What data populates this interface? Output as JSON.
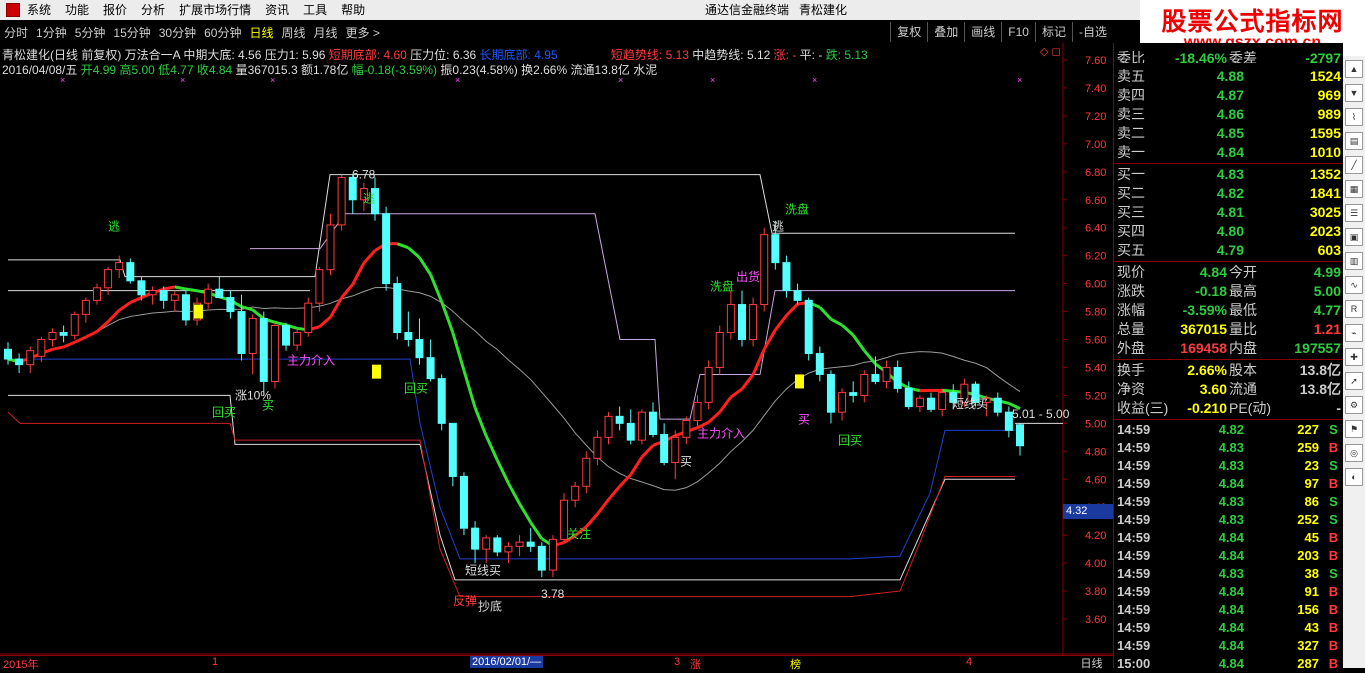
{
  "menu": [
    "系统",
    "功能",
    "报价",
    "分析",
    "扩展市场行情",
    "资讯",
    "工具",
    "帮助"
  ],
  "window_title": "通达信金融终端",
  "stock_title": "青松建化",
  "brand": {
    "line1": "股票公式指标网",
    "line2": "www.gszx.com.cn"
  },
  "periods": [
    "分时",
    "1分钟",
    "5分钟",
    "15分钟",
    "30分钟",
    "60分钟",
    "日线",
    "周线",
    "月线",
    "更多 >"
  ],
  "active_period": "日线",
  "right_buttons": [
    "复权",
    "叠加",
    "画线",
    "F10",
    "标记",
    "-自选"
  ],
  "info_line1": {
    "name": "青松建化(日线 前复权) 万法合一A",
    "zhongqi": "中期大底: 4.56",
    "yali1": "压力1: 5.96",
    "duanqi": "短期底部: 4.60",
    "yaliwei": "压力位: 6.36",
    "changqi": "长期底部: 4.95",
    "duanqushi": "短趋势线: 5.13",
    "zhongqushi": "中趋势线: 5.12",
    "zhang": "涨: -",
    "ping": "平: -",
    "die": "跌: 5.13"
  },
  "info_line2": {
    "date": "2016/04/08/五",
    "open": "开4.99",
    "high": "高5.00",
    "low": "低4.77",
    "close": "收4.84",
    "vol": "量367015.3",
    "amt": "额1.78亿",
    "chg": "幅-0.18(-3.59%)",
    "amp": "振0.23(4.58%)",
    "turn": "换2.66%",
    "float": "流通13.8亿",
    "ind": "水泥"
  },
  "y_axis": [
    "7.60",
    "7.40",
    "7.20",
    "7.00",
    "6.80",
    "6.60",
    "6.40",
    "6.20",
    "6.00",
    "5.80",
    "5.60",
    "5.40",
    "5.20",
    "5.00",
    "4.80",
    "4.60",
    "4.40",
    "4.20",
    "4.00",
    "3.80",
    "3.60"
  ],
  "chart_labels": {
    "high_mark": "6.78",
    "low_mark": "3.78",
    "taotop": "逃",
    "tao2": "逃",
    "tao3": "逃",
    "xipan": "洗盘",
    "xipan2": "洗盘",
    "chuhuo": "出货",
    "zhuli1": "主力介入",
    "zhuli2": "主力介入",
    "huimai1": "回买",
    "huimai2": "回买",
    "huimai3": "回买",
    "zhang10": "涨10%",
    "mai1": "买",
    "mai2": "买",
    "mai3": "买",
    "duanxian": "短线买",
    "duanxian2": "短线买",
    "fantan": "反弹",
    "chaodi": "抄底",
    "guanzhu": "关注",
    "range": "5.01 - 5.00"
  },
  "price_box": "4.32",
  "bottom_labels": {
    "year": "2015年",
    "m1": "1",
    "date": "2016/02/01/—",
    "m3": "3",
    "m4": "4",
    "zhang": "涨",
    "bang": "榜",
    "day": "日线"
  },
  "order_book": {
    "header": "委比",
    "header_val": "-18.46%",
    "header2": "委差",
    "header2_val": "-2797",
    "sells": [
      {
        "label": "卖五",
        "price": "4.88",
        "vol": "1524"
      },
      {
        "label": "卖四",
        "price": "4.87",
        "vol": "969"
      },
      {
        "label": "卖三",
        "price": "4.86",
        "vol": "989"
      },
      {
        "label": "卖二",
        "price": "4.85",
        "vol": "1595"
      },
      {
        "label": "卖一",
        "price": "4.84",
        "vol": "1010"
      }
    ],
    "buys": [
      {
        "label": "买一",
        "price": "4.83",
        "vol": "1352"
      },
      {
        "label": "买二",
        "price": "4.82",
        "vol": "1841"
      },
      {
        "label": "买三",
        "price": "4.81",
        "vol": "3025"
      },
      {
        "label": "买四",
        "price": "4.80",
        "vol": "2023"
      },
      {
        "label": "买五",
        "price": "4.79",
        "vol": "603"
      }
    ]
  },
  "quote": [
    {
      "l1": "现价",
      "v1": "4.84",
      "l2": "今开",
      "v2": "4.99",
      "c1": "#2ecc40",
      "c2": "#2ecc40"
    },
    {
      "l1": "涨跌",
      "v1": "-0.18",
      "l2": "最高",
      "v2": "5.00",
      "c1": "#2ecc40",
      "c2": "#2ecc40"
    },
    {
      "l1": "涨幅",
      "v1": "-3.59%",
      "l2": "最低",
      "v2": "4.77",
      "c1": "#2ecc40",
      "c2": "#2ecc40"
    },
    {
      "l1": "总量",
      "v1": "367015",
      "l2": "量比",
      "v2": "1.21",
      "c1": "#ffff00",
      "c2": "#ff3b3b"
    },
    {
      "l1": "外盘",
      "v1": "169458",
      "l2": "内盘",
      "v2": "197557",
      "c1": "#ff3b3b",
      "c2": "#2ecc40"
    },
    {
      "l1": "换手",
      "v1": "2.66%",
      "l2": "股本",
      "v2": "13.8亿",
      "c1": "#ffff00",
      "c2": "#ccc"
    },
    {
      "l1": "净资",
      "v1": "3.60",
      "l2": "流通",
      "v2": "13.8亿",
      "c1": "#ffff00",
      "c2": "#ccc"
    },
    {
      "l1": "收益(三)",
      "v1": "-0.210",
      "l2": "PE(动)",
      "v2": "-",
      "c1": "#ffff00",
      "c2": "#ccc"
    }
  ],
  "ticks": [
    {
      "t": "14:59",
      "p": "4.82",
      "q": "227",
      "d": "S"
    },
    {
      "t": "14:59",
      "p": "4.83",
      "q": "259",
      "d": "B"
    },
    {
      "t": "14:59",
      "p": "4.83",
      "q": "23",
      "d": "S"
    },
    {
      "t": "14:59",
      "p": "4.84",
      "q": "97",
      "d": "B"
    },
    {
      "t": "14:59",
      "p": "4.83",
      "q": "86",
      "d": "S"
    },
    {
      "t": "14:59",
      "p": "4.83",
      "q": "252",
      "d": "S"
    },
    {
      "t": "14:59",
      "p": "4.84",
      "q": "45",
      "d": "B"
    },
    {
      "t": "14:59",
      "p": "4.84",
      "q": "203",
      "d": "B"
    },
    {
      "t": "14:59",
      "p": "4.83",
      "q": "38",
      "d": "S"
    },
    {
      "t": "14:59",
      "p": "4.84",
      "q": "91",
      "d": "B"
    },
    {
      "t": "14:59",
      "p": "4.84",
      "q": "156",
      "d": "B"
    },
    {
      "t": "14:59",
      "p": "4.84",
      "q": "43",
      "d": "B"
    },
    {
      "t": "14:59",
      "p": "4.84",
      "q": "327",
      "d": "B"
    },
    {
      "t": "15:00",
      "p": "4.84",
      "q": "287",
      "d": "B"
    }
  ],
  "candles": [
    [
      5.53,
      5.58,
      5.42,
      5.46
    ],
    [
      5.46,
      5.5,
      5.36,
      5.42
    ],
    [
      5.42,
      5.55,
      5.36,
      5.52
    ],
    [
      5.48,
      5.62,
      5.44,
      5.6
    ],
    [
      5.6,
      5.68,
      5.55,
      5.65
    ],
    [
      5.65,
      5.7,
      5.58,
      5.63
    ],
    [
      5.63,
      5.8,
      5.6,
      5.78
    ],
    [
      5.78,
      5.9,
      5.72,
      5.88
    ],
    [
      5.88,
      6.0,
      5.85,
      5.97
    ],
    [
      5.97,
      6.12,
      5.92,
      6.1
    ],
    [
      6.1,
      6.2,
      6.04,
      6.15
    ],
    [
      6.15,
      6.18,
      6.0,
      6.02
    ],
    [
      6.02,
      6.05,
      5.88,
      5.92
    ],
    [
      5.92,
      5.98,
      5.85,
      5.95
    ],
    [
      5.95,
      5.98,
      5.82,
      5.88
    ],
    [
      5.88,
      5.95,
      5.8,
      5.92
    ],
    [
      5.92,
      5.95,
      5.7,
      5.74
    ],
    [
      5.74,
      5.9,
      5.7,
      5.86
    ],
    [
      5.86,
      6.0,
      5.82,
      5.96
    ],
    [
      5.96,
      6.05,
      5.9,
      5.9
    ],
    [
      5.9,
      5.95,
      5.75,
      5.8
    ],
    [
      5.8,
      5.92,
      5.45,
      5.5
    ],
    [
      5.5,
      5.78,
      5.35,
      5.75
    ],
    [
      5.75,
      5.8,
      5.2,
      5.3
    ],
    [
      5.3,
      5.72,
      5.25,
      5.7
    ],
    [
      5.7,
      5.72,
      5.52,
      5.56
    ],
    [
      5.56,
      5.68,
      5.52,
      5.65
    ],
    [
      5.65,
      5.9,
      5.62,
      5.86
    ],
    [
      5.86,
      6.12,
      5.8,
      6.1
    ],
    [
      6.1,
      6.5,
      6.06,
      6.42
    ],
    [
      6.42,
      6.78,
      6.38,
      6.76
    ],
    [
      6.76,
      6.78,
      6.5,
      6.6
    ],
    [
      6.6,
      6.72,
      6.52,
      6.68
    ],
    [
      6.68,
      6.76,
      6.45,
      6.5
    ],
    [
      6.5,
      6.55,
      5.95,
      6.0
    ],
    [
      6.0,
      6.05,
      5.6,
      5.65
    ],
    [
      5.65,
      5.8,
      5.55,
      5.6
    ],
    [
      5.6,
      5.75,
      5.42,
      5.47
    ],
    [
      5.47,
      5.6,
      5.3,
      5.32
    ],
    [
      5.32,
      5.35,
      4.95,
      5.0
    ],
    [
      5.0,
      5.0,
      4.55,
      4.62
    ],
    [
      4.62,
      4.65,
      4.2,
      4.25
    ],
    [
      4.25,
      4.3,
      4.0,
      4.1
    ],
    [
      4.1,
      4.2,
      4.0,
      4.18
    ],
    [
      4.18,
      4.2,
      4.05,
      4.08
    ],
    [
      4.08,
      4.15,
      4.0,
      4.12
    ],
    [
      4.12,
      4.2,
      4.05,
      4.15
    ],
    [
      4.15,
      4.25,
      4.08,
      4.12
    ],
    [
      4.12,
      4.15,
      3.9,
      3.95
    ],
    [
      3.95,
      4.2,
      3.9,
      4.17
    ],
    [
      4.17,
      4.5,
      4.15,
      4.45
    ],
    [
      4.45,
      4.58,
      4.4,
      4.55
    ],
    [
      4.55,
      4.8,
      4.5,
      4.75
    ],
    [
      4.75,
      4.95,
      4.7,
      4.9
    ],
    [
      4.9,
      5.08,
      4.85,
      5.05
    ],
    [
      5.05,
      5.12,
      4.95,
      5.0
    ],
    [
      5.0,
      5.1,
      4.85,
      4.88
    ],
    [
      4.88,
      5.1,
      4.85,
      5.08
    ],
    [
      5.08,
      5.15,
      4.9,
      4.92
    ],
    [
      4.92,
      5.0,
      4.7,
      4.72
    ],
    [
      4.72,
      4.95,
      4.6,
      4.9
    ],
    [
      4.9,
      5.05,
      4.85,
      5.02
    ],
    [
      5.02,
      5.2,
      4.98,
      5.15
    ],
    [
      5.15,
      5.45,
      5.1,
      5.4
    ],
    [
      5.4,
      5.7,
      5.35,
      5.65
    ],
    [
      5.65,
      5.95,
      5.6,
      5.85
    ],
    [
      5.85,
      5.95,
      5.55,
      5.6
    ],
    [
      5.6,
      5.9,
      5.55,
      5.85
    ],
    [
      5.85,
      6.4,
      5.8,
      6.35
    ],
    [
      6.35,
      6.45,
      6.1,
      6.15
    ],
    [
      6.15,
      6.2,
      5.9,
      5.95
    ],
    [
      5.95,
      6.0,
      5.85,
      5.88
    ],
    [
      5.88,
      5.9,
      5.45,
      5.5
    ],
    [
      5.5,
      5.55,
      5.3,
      5.35
    ],
    [
      5.35,
      5.38,
      5.0,
      5.08
    ],
    [
      5.08,
      5.25,
      5.02,
      5.22
    ],
    [
      5.22,
      5.3,
      5.15,
      5.2
    ],
    [
      5.2,
      5.38,
      5.15,
      5.35
    ],
    [
      5.35,
      5.48,
      5.28,
      5.3
    ],
    [
      5.3,
      5.45,
      5.25,
      5.4
    ],
    [
      5.4,
      5.45,
      5.22,
      5.25
    ],
    [
      5.25,
      5.3,
      5.1,
      5.12
    ],
    [
      5.12,
      5.2,
      5.08,
      5.18
    ],
    [
      5.18,
      5.22,
      5.08,
      5.1
    ],
    [
      5.1,
      5.25,
      5.05,
      5.22
    ],
    [
      5.22,
      5.28,
      5.1,
      5.15
    ],
    [
      5.15,
      5.32,
      5.12,
      5.28
    ],
    [
      5.28,
      5.3,
      5.12,
      5.15
    ],
    [
      5.15,
      5.2,
      5.05,
      5.18
    ],
    [
      5.18,
      5.22,
      5.05,
      5.08
    ],
    [
      5.08,
      5.12,
      4.9,
      4.95
    ],
    [
      4.99,
      5.0,
      4.77,
      4.84
    ]
  ]
}
